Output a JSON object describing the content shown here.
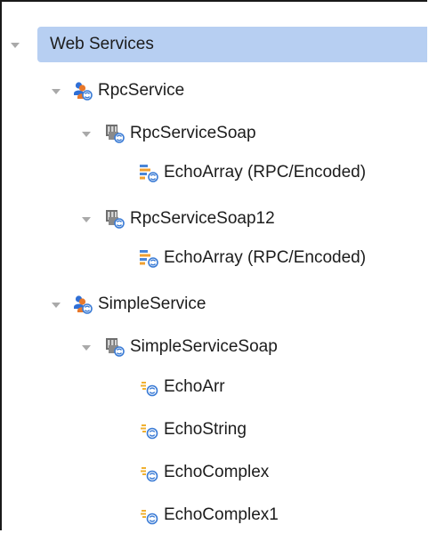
{
  "tree": {
    "root": {
      "label": "Web Services"
    },
    "services": [
      {
        "label": "RpcService",
        "icon": "service-icon",
        "ports": [
          {
            "label": "RpcServiceSoap",
            "icon": "port-icon",
            "operations": [
              {
                "label": "EchoArray (RPC/Encoded)",
                "icon": "rpc-operation-icon"
              }
            ]
          },
          {
            "label": "RpcServiceSoap12",
            "icon": "port-icon",
            "operations": [
              {
                "label": "EchoArray (RPC/Encoded)",
                "icon": "rpc-operation-icon"
              }
            ]
          }
        ]
      },
      {
        "label": "SimpleService",
        "icon": "service-icon",
        "ports": [
          {
            "label": "SimpleServiceSoap",
            "icon": "port-icon",
            "operations": [
              {
                "label": "EchoArr",
                "icon": "operation-icon"
              },
              {
                "label": "EchoString",
                "icon": "operation-icon"
              },
              {
                "label": "EchoComplex",
                "icon": "operation-icon"
              },
              {
                "label": "EchoComplex1",
                "icon": "operation-icon"
              }
            ]
          }
        ]
      }
    ]
  },
  "colors": {
    "selection": "#b7cff2",
    "twisty": "#a9a9a9",
    "text": "#1c1c1c"
  }
}
